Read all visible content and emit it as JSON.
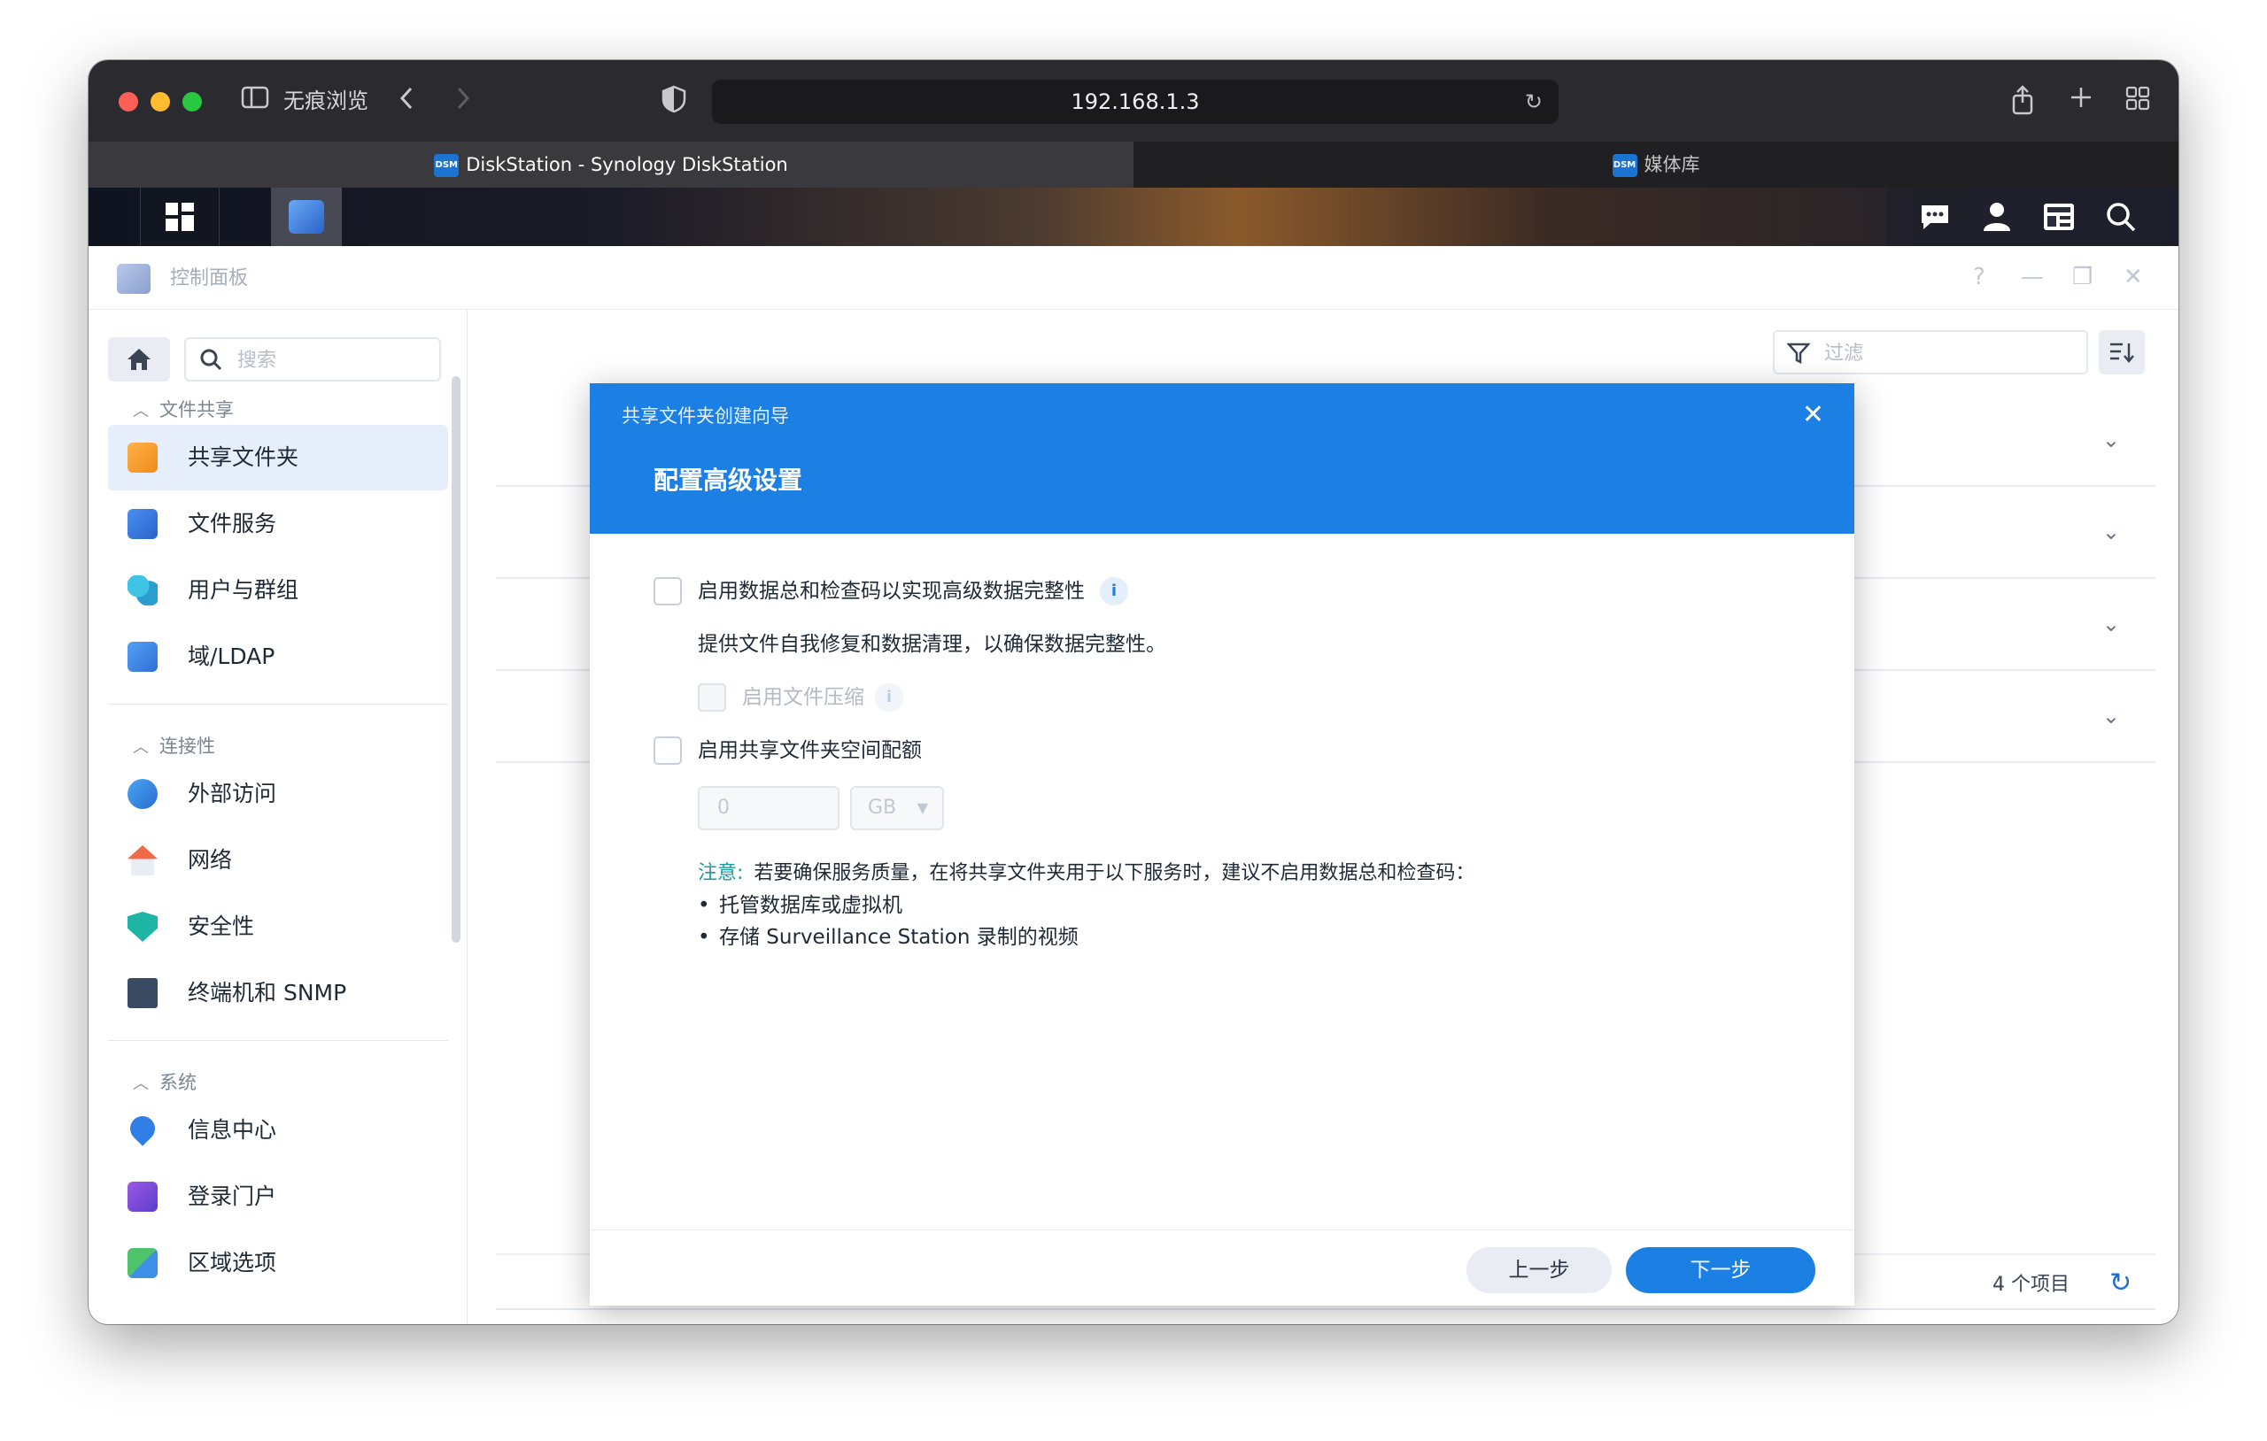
{
  "browser": {
    "private_label": "无痕浏览",
    "url": "192.168.1.3",
    "tabs": [
      {
        "badge": "DSM",
        "label": "DiskStation - Synology DiskStation"
      },
      {
        "badge": "DSM",
        "label": "媒体库"
      }
    ]
  },
  "control_panel": {
    "title": "控制面板",
    "search_placeholder": "搜索",
    "sections": [
      {
        "label": "文件共享",
        "items": [
          "共享文件夹",
          "文件服务",
          "用户与群组",
          "域/LDAP"
        ]
      },
      {
        "label": "连接性",
        "items": [
          "外部访问",
          "网络",
          "安全性",
          "终端机和 SNMP"
        ]
      },
      {
        "label": "系统",
        "items": [
          "信息中心",
          "登录门户",
          "区域选项"
        ]
      }
    ],
    "active_item": "共享文件夹",
    "filter_placeholder": "过滤",
    "item_count": "4 个项目"
  },
  "wizard": {
    "title": "共享文件夹创建向导",
    "step_title": "配置高级设置",
    "checksum_label": "启用数据总和检查码以实现高级数据完整性",
    "checksum_desc": "提供文件自我修复和数据清理，以确保数据完整性。",
    "compression_label": "启用文件压缩",
    "quota_label": "启用共享文件夹空间配额",
    "quota_value": "0",
    "quota_unit": "GB",
    "note_lead": "注意:",
    "note_text": "若要确保服务质量，在将共享文件夹用于以下服务时，建议不启用数据总和检查码：",
    "note_bullets": [
      "托管数据库或虚拟机",
      "存储 Surveillance Station 录制的视频"
    ],
    "prev_label": "上一步",
    "next_label": "下一步"
  },
  "icons": {
    "close": "✕",
    "chevron_down": "⌄",
    "info": "i"
  }
}
